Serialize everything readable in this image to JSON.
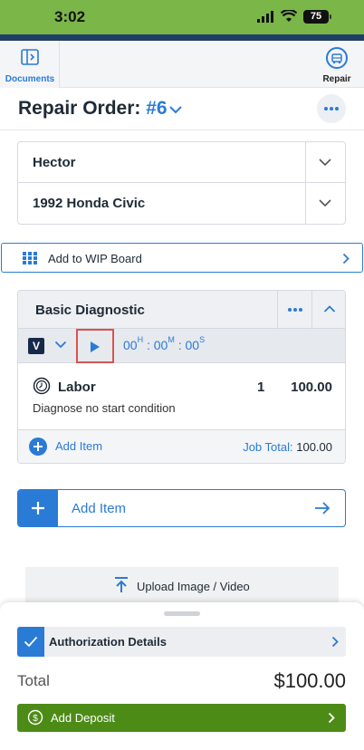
{
  "status_bar": {
    "time": "3:02",
    "battery": "75"
  },
  "tabs": {
    "documents_label": "Documents",
    "repair_label": "Repair"
  },
  "header": {
    "title_prefix": "Repair Order:",
    "order_number": "#6"
  },
  "selects": {
    "customer": "Hector",
    "vehicle": "1992 Honda Civic"
  },
  "wip": {
    "label": "Add to WIP Board"
  },
  "job": {
    "title": "Basic Diagnostic",
    "badge": "V",
    "timer": {
      "hours": "00",
      "hours_unit": "H",
      "minutes": "00",
      "minutes_unit": "M",
      "seconds": "00",
      "seconds_unit": "S"
    },
    "labor": {
      "label": "Labor",
      "qty": "1",
      "amount": "100.00",
      "description": "Diagnose no start condition"
    },
    "add_item_label": "Add Item",
    "total_label": "Job Total:",
    "total_value": "100.00"
  },
  "add_item_big": {
    "label": "Add Item"
  },
  "upload": {
    "label": "Upload Image / Video"
  },
  "sheet": {
    "authorization_label": "Authorization Details",
    "total_label": "Total",
    "total_value": "$100.00",
    "deposit_label": "Add Deposit"
  },
  "colors": {
    "accent": "#2a7bd6",
    "status_bar": "#7ab648",
    "deposit": "#4d8b17",
    "navy": "#17294a"
  }
}
